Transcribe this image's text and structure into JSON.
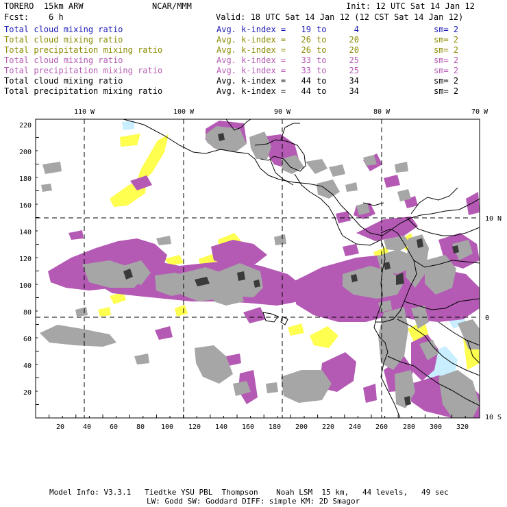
{
  "header": {
    "model": "TORERO  15km ARW",
    "center": "NCAR/MMM",
    "init": "Init: 12 UTC Sat 14 Jan 12",
    "fcst": "Fcst:    6 h",
    "valid": "Valid: 18 UTC Sat 14 Jan 12 (12 CST Sat 14 Jan 12)"
  },
  "legend": [
    {
      "variable": "Total cloud mixing ratio",
      "kindex_label": "Avg. k-index =",
      "low": "19",
      "to": "to",
      "high": "4",
      "sm": "sm= 2",
      "color": "#1a1ab4"
    },
    {
      "variable": "Total cloud mixing ratio",
      "kindex_label": "Avg. k-index =",
      "low": "26",
      "to": "to",
      "high": "20",
      "sm": "sm= 2",
      "color": "#8a8a00"
    },
    {
      "variable": "Total precipitation mixing ratio",
      "kindex_label": "Avg. k-index =",
      "low": "26",
      "to": "to",
      "high": "20",
      "sm": "sm= 2",
      "color": "#8a8a00"
    },
    {
      "variable": "Total cloud mixing ratio",
      "kindex_label": "Avg. k-index =",
      "low": "33",
      "to": "to",
      "high": "25",
      "sm": "sm= 2",
      "color": "#b45ab4"
    },
    {
      "variable": "Total precipitation mixing ratio",
      "kindex_label": "Avg. k-index =",
      "low": "33",
      "to": "to",
      "high": "25",
      "sm": "sm= 2",
      "color": "#b45ab4"
    },
    {
      "variable": "Total cloud mixing ratio",
      "kindex_label": "Avg. k-index =",
      "low": "44",
      "to": "to",
      "high": "34",
      "sm": "sm= 2",
      "color": "#000000"
    },
    {
      "variable": "Total precipitation mixing ratio",
      "kindex_label": "Avg. k-index =",
      "low": "44",
      "to": "to",
      "high": "34",
      "sm": "sm= 2",
      "color": "#000000"
    }
  ],
  "map": {
    "lon_labels": [
      "110 W",
      "100 W",
      "90 W",
      "80 W",
      "70 W"
    ],
    "lat_labels": [
      "10 N",
      "0",
      "10 S"
    ],
    "y_ticks": [
      "220",
      "200",
      "180",
      "160",
      "140",
      "120",
      "100",
      "80",
      "60",
      "40",
      "20"
    ],
    "x_ticks": [
      "20",
      "40",
      "60",
      "80",
      "100",
      "120",
      "140",
      "160",
      "180",
      "200",
      "220",
      "240",
      "260",
      "280",
      "300",
      "320"
    ],
    "colors": {
      "gray": "#a6a6a6",
      "purple": "#b45ab4",
      "yellow": "#ffff50",
      "lightblue": "#c8eeff",
      "dark": "#3a3a3a"
    }
  },
  "footer": {
    "line1": "Model Info: V3.3.1   Tiedtke YSU PBL  Thompson    Noah LSM  15 km,   44 levels,   49 sec",
    "line2": "LW: Godd SW: Goddard DIFF: simple KM: 2D Smagor"
  }
}
